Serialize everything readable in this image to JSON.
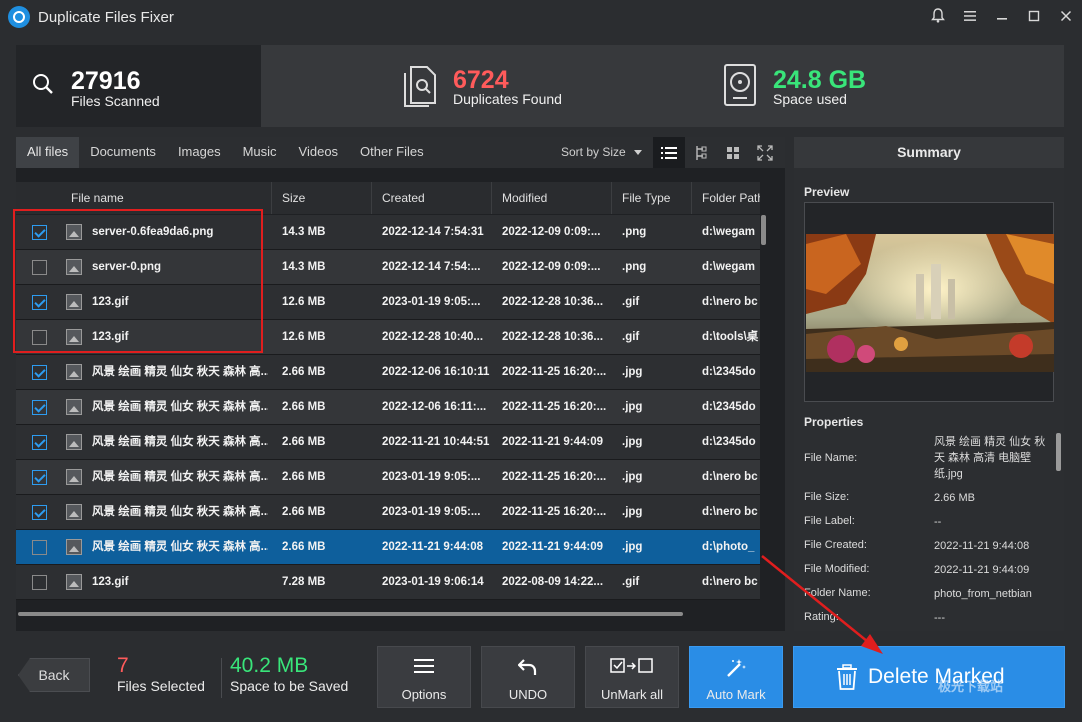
{
  "window": {
    "title": "Duplicate Files Fixer"
  },
  "stats": {
    "scanned": {
      "value": "27916",
      "label": "Files Scanned"
    },
    "duplicates": {
      "value": "6724",
      "label": "Duplicates Found"
    },
    "space": {
      "value": "24.8 GB",
      "label": "Space used"
    }
  },
  "tabs": [
    "All files",
    "Documents",
    "Images",
    "Music",
    "Videos",
    "Other Files"
  ],
  "sort_label": "Sort by Size",
  "columns": [
    "File name",
    "Size",
    "Created",
    "Modified",
    "File Type",
    "Folder Path"
  ],
  "rows": [
    {
      "checked": true,
      "name": "server-0.6fea9da6.png",
      "size": "14.3 MB",
      "created": "2022-12-14 7:54:31",
      "modified": "2022-12-09 0:09:...",
      "type": ".png",
      "path": "d:\\wegam",
      "highlight": false
    },
    {
      "checked": false,
      "name": "server-0.png",
      "size": "14.3 MB",
      "created": "2022-12-14 7:54:...",
      "modified": "2022-12-09 0:09:...",
      "type": ".png",
      "path": "d:\\wegam",
      "highlight": false
    },
    {
      "checked": true,
      "name": "123.gif",
      "size": "12.6 MB",
      "created": "2023-01-19 9:05:...",
      "modified": "2022-12-28 10:36...",
      "type": ".gif",
      "path": "d:\\nero bc",
      "highlight": false
    },
    {
      "checked": false,
      "name": "123.gif",
      "size": "12.6 MB",
      "created": "2022-12-28 10:40...",
      "modified": "2022-12-28 10:36...",
      "type": ".gif",
      "path": "d:\\tools\\桌",
      "highlight": false
    },
    {
      "checked": true,
      "name": "风景 绘画 精灵 仙女 秋天 森林 高...",
      "size": "2.66 MB",
      "created": "2022-12-06 16:10:11",
      "modified": "2022-11-25 16:20:...",
      "type": ".jpg",
      "path": "d:\\2345do",
      "highlight": false
    },
    {
      "checked": true,
      "name": "风景 绘画 精灵 仙女 秋天 森林 高...",
      "size": "2.66 MB",
      "created": "2022-12-06 16:11:...",
      "modified": "2022-11-25 16:20:...",
      "type": ".jpg",
      "path": "d:\\2345do",
      "highlight": false
    },
    {
      "checked": true,
      "name": "风景 绘画 精灵 仙女 秋天 森林 高...",
      "size": "2.66 MB",
      "created": "2022-11-21 10:44:51",
      "modified": "2022-11-21 9:44:09",
      "type": ".jpg",
      "path": "d:\\2345do",
      "highlight": false
    },
    {
      "checked": true,
      "name": "风景 绘画 精灵 仙女 秋天 森林 高...",
      "size": "2.66 MB",
      "created": "2023-01-19 9:05:...",
      "modified": "2022-11-25 16:20:...",
      "type": ".jpg",
      "path": "d:\\nero bc",
      "highlight": false
    },
    {
      "checked": true,
      "name": "风景 绘画 精灵 仙女 秋天 森林 高...",
      "size": "2.66 MB",
      "created": "2023-01-19 9:05:...",
      "modified": "2022-11-25 16:20:...",
      "type": ".jpg",
      "path": "d:\\nero bc",
      "highlight": false
    },
    {
      "checked": false,
      "name": "风景 绘画 精灵 仙女 秋天 森林 高...",
      "size": "2.66 MB",
      "created": "2022-11-21 9:44:08",
      "modified": "2022-11-21 9:44:09",
      "type": ".jpg",
      "path": "d:\\photo_",
      "highlight": true
    },
    {
      "checked": false,
      "name": "123.gif",
      "size": "7.28 MB",
      "created": "2023-01-19 9:06:14",
      "modified": "2022-08-09 14:22...",
      "type": ".gif",
      "path": "d:\\nero bc",
      "highlight": false
    }
  ],
  "summary": {
    "title": "Summary",
    "preview_label": "Preview",
    "properties_label": "Properties",
    "properties": [
      {
        "key": "File Name:",
        "value": "风景 绘画 精灵 仙女 秋天 森林 高清 电脑壁纸.jpg"
      },
      {
        "key": "File Size:",
        "value": "2.66 MB"
      },
      {
        "key": "File Label:",
        "value": "--"
      },
      {
        "key": "File Created:",
        "value": "2022-11-21 9:44:08"
      },
      {
        "key": "File Modified:",
        "value": "2022-11-21 9:44:09"
      },
      {
        "key": "Folder Name:",
        "value": "photo_from_netbian"
      },
      {
        "key": "Rating:",
        "value": "---"
      }
    ]
  },
  "bottom": {
    "back_label": "Back",
    "selected": {
      "value": "7",
      "label": "Files Selected"
    },
    "saved": {
      "value": "40.2 MB",
      "label": "Space to be Saved"
    },
    "options_label": "Options",
    "undo_label": "UNDO",
    "unmark_label": "UnMark all",
    "automark_label": "Auto Mark",
    "delete_label": "Delete Marked"
  },
  "watermark": "极光下载站",
  "colors": {
    "accent": "#2a8de6",
    "duplicates": "#ff5b5b",
    "space": "#39e57a",
    "annotation": "#e01e1e"
  }
}
